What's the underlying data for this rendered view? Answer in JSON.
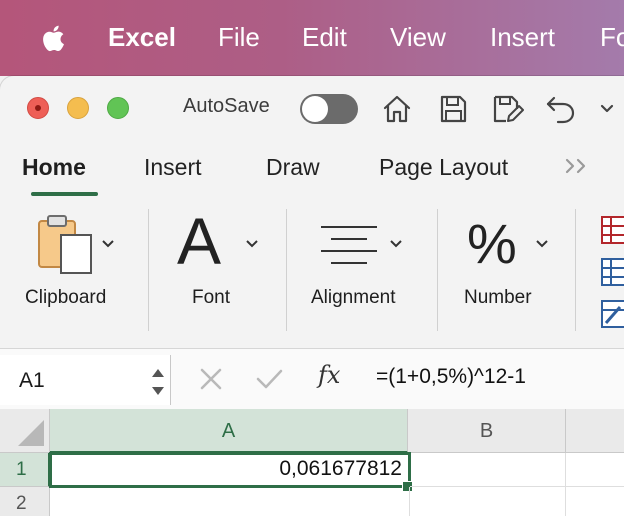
{
  "menubar": {
    "app": "Excel",
    "items": [
      "File",
      "Edit",
      "View",
      "Insert",
      "Fo"
    ]
  },
  "titlebar": {
    "autosave_label": "AutoSave",
    "autosave_on": false
  },
  "tabs": [
    "Home",
    "Insert",
    "Draw",
    "Page Layout"
  ],
  "active_tab": "Home",
  "ribbon": {
    "groups": [
      "Clipboard",
      "Font",
      "Alignment",
      "Number"
    ],
    "font_glyph": "A",
    "number_glyph": "%"
  },
  "formula_bar": {
    "name_box": "A1",
    "fx": "fx",
    "formula": "=(1+0,5%)^12-1"
  },
  "grid": {
    "columns": [
      "A",
      "B"
    ],
    "rows": [
      "1",
      "2"
    ],
    "cells": {
      "A1": "0,061677812"
    }
  },
  "colors": {
    "accent": "#2e6e47",
    "menubar_start": "#b4567a",
    "menubar_end": "#a47bab"
  }
}
